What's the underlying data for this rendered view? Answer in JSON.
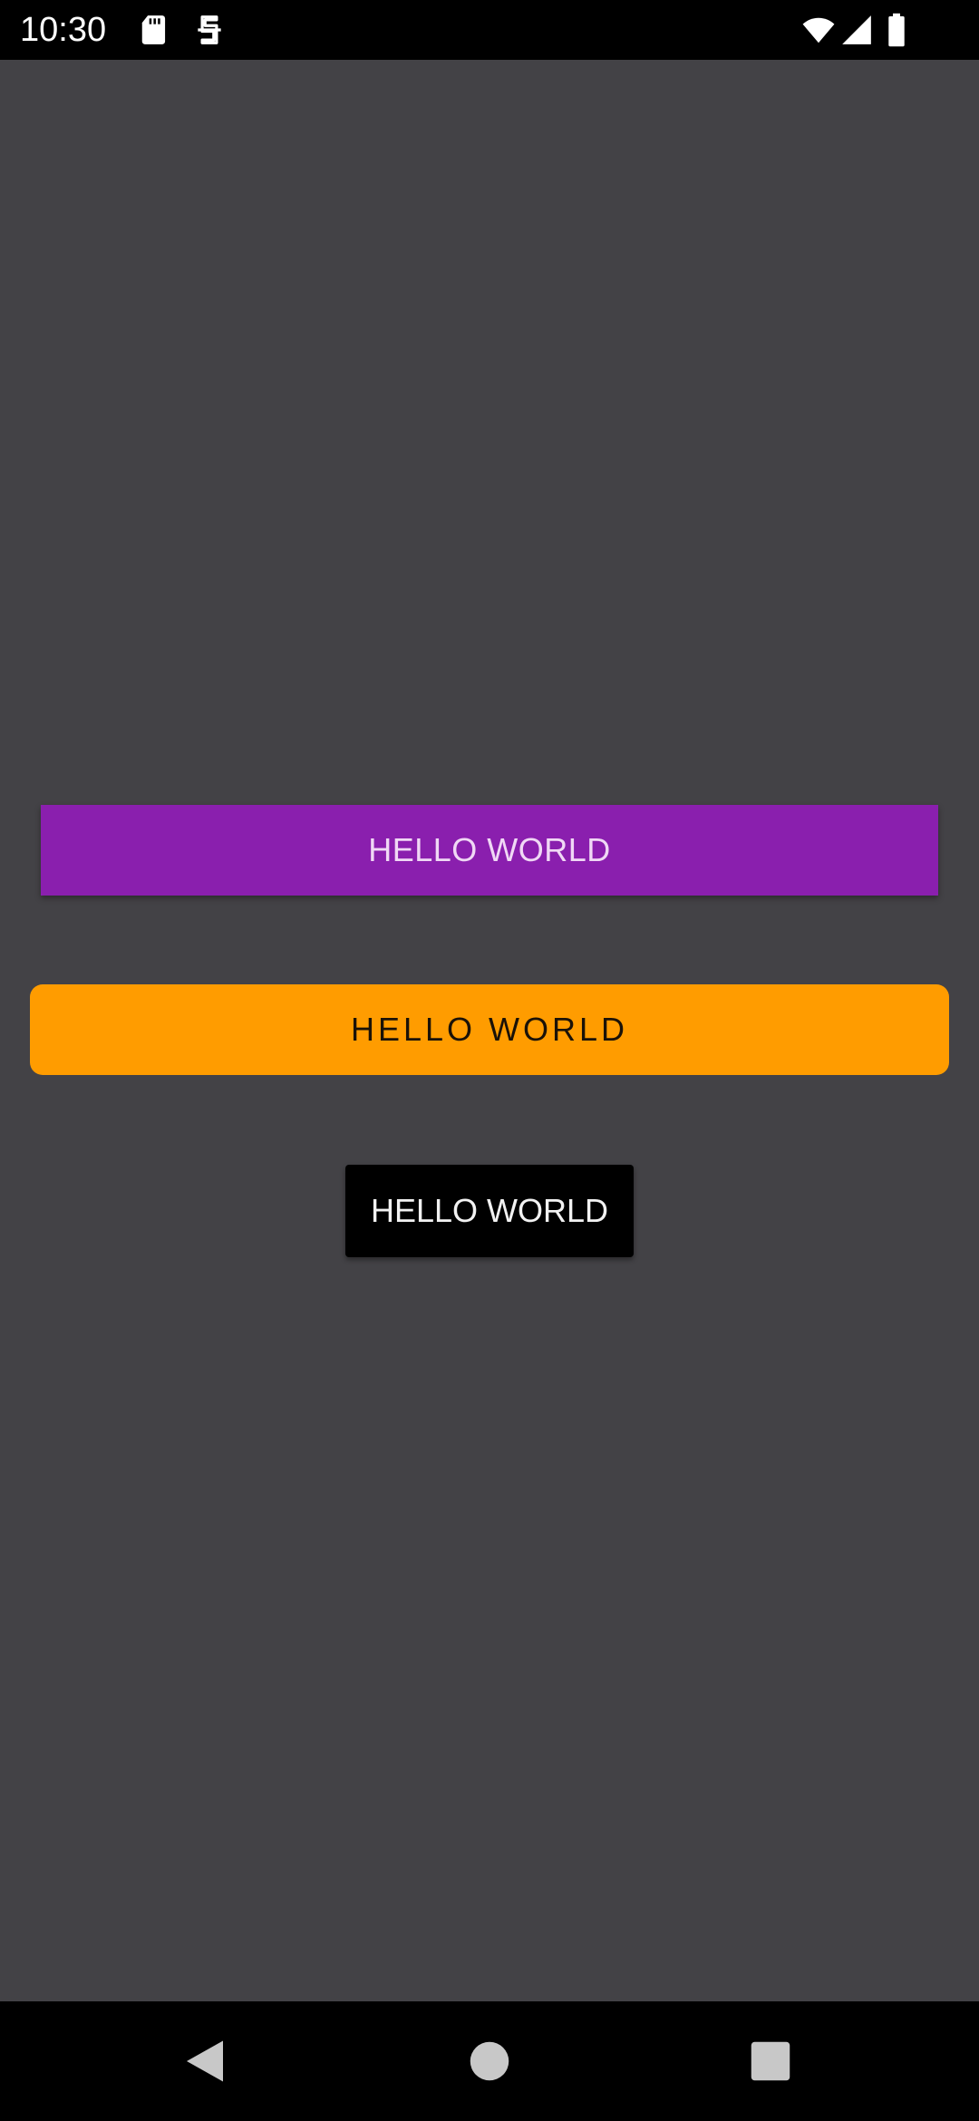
{
  "status_bar": {
    "time": "10:30",
    "icons": [
      "sd-card-icon",
      "sync-icon",
      "wifi-icon",
      "signal-icon",
      "battery-icon"
    ]
  },
  "buttons": [
    {
      "label": "HELLO WORLD",
      "color": "#8a1fae",
      "text_color": "#f0d8f5"
    },
    {
      "label": "HELLO WORLD",
      "color": "#ff9c00",
      "text_color": "#1a1208"
    },
    {
      "label": "HELLO WORLD",
      "color": "#000000",
      "text_color": "#f2f2f2"
    }
  ],
  "navigation": {
    "icons": [
      "back-icon",
      "home-icon",
      "recents-icon"
    ]
  },
  "colors": {
    "background": "#434246",
    "system_bars": "#000000"
  }
}
